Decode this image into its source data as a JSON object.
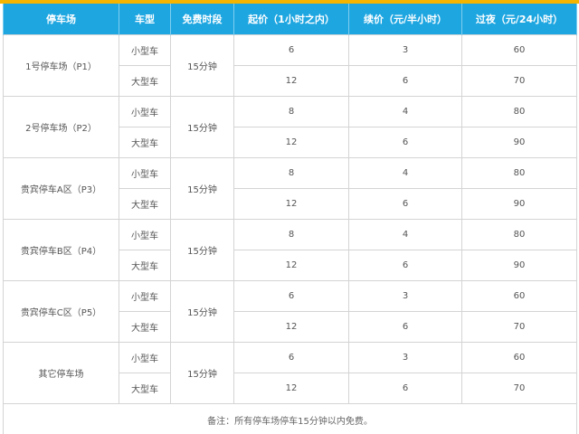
{
  "colors": {
    "header_bg": "#1ea6e1",
    "top_bar": "#f5b400",
    "header_text": "#ffffff",
    "border": "#d4d4d4"
  },
  "header": {
    "lot": "停车场",
    "vehicle_type": "车型",
    "free_period": "免费时段",
    "start_price": "起价（1小时之内）",
    "extra_price": "续价（元/半小时）",
    "overnight": "过夜（元/24小时）"
  },
  "lots": [
    {
      "name": "1号停车场（P1）",
      "free": "15分钟",
      "rows": [
        {
          "type": "小型车",
          "start": "6",
          "extra": "3",
          "overnight": "60"
        },
        {
          "type": "大型车",
          "start": "12",
          "extra": "6",
          "overnight": "70"
        }
      ]
    },
    {
      "name": "2号停车场（P2）",
      "free": "15分钟",
      "rows": [
        {
          "type": "小型车",
          "start": "8",
          "extra": "4",
          "overnight": "80"
        },
        {
          "type": "大型车",
          "start": "12",
          "extra": "6",
          "overnight": "90"
        }
      ]
    },
    {
      "name": "贵宾停车A区（P3）",
      "free": "15分钟",
      "rows": [
        {
          "type": "小型车",
          "start": "8",
          "extra": "4",
          "overnight": "80"
        },
        {
          "type": "大型车",
          "start": "12",
          "extra": "6",
          "overnight": "90"
        }
      ]
    },
    {
      "name": "贵宾停车B区（P4）",
      "free": "15分钟",
      "rows": [
        {
          "type": "小型车",
          "start": "8",
          "extra": "4",
          "overnight": "80"
        },
        {
          "type": "大型车",
          "start": "12",
          "extra": "6",
          "overnight": "90"
        }
      ]
    },
    {
      "name": "贵宾停车C区（P5）",
      "free": "15分钟",
      "rows": [
        {
          "type": "小型车",
          "start": "6",
          "extra": "3",
          "overnight": "60"
        },
        {
          "type": "大型车",
          "start": "12",
          "extra": "6",
          "overnight": "70"
        }
      ]
    },
    {
      "name": "其它停车场",
      "free": "15分钟",
      "rows": [
        {
          "type": "小型车",
          "start": "6",
          "extra": "3",
          "overnight": "60"
        },
        {
          "type": "大型车",
          "start": "12",
          "extra": "6",
          "overnight": "70"
        }
      ]
    }
  ],
  "note": "备注：所有停车场停车15分钟以内免费。"
}
